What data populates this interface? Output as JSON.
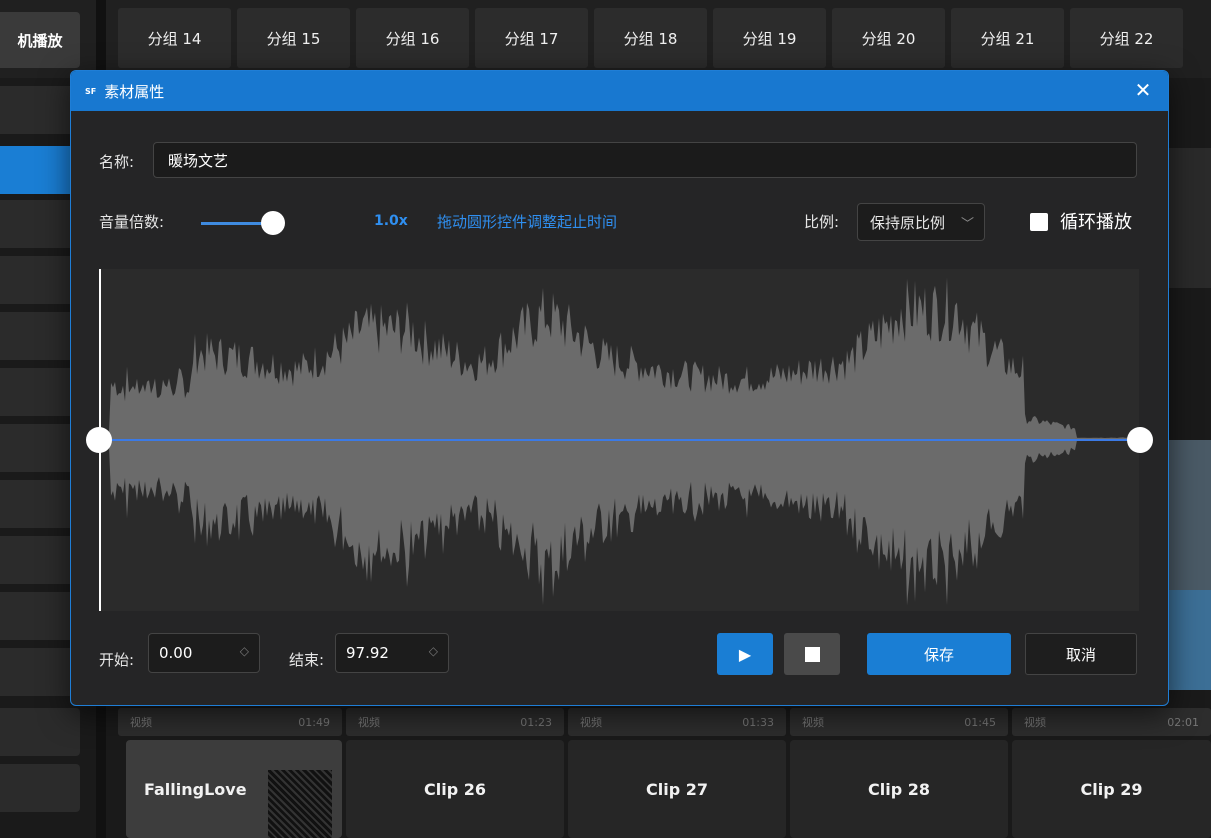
{
  "background": {
    "mode_button": "机播放",
    "group_tabs": [
      "分组 14",
      "分组 15",
      "分组 16",
      "分组 17",
      "分组 18",
      "分组 19",
      "分组 20",
      "分组 21",
      "分组 22"
    ],
    "clips": [
      {
        "type": "视频",
        "duration": "01:49",
        "name": "FallingLove"
      },
      {
        "type": "视频",
        "duration": "01:23",
        "name": "Clip 26"
      },
      {
        "type": "视频",
        "duration": "01:33",
        "name": "Clip 27"
      },
      {
        "type": "视频",
        "duration": "01:45",
        "name": "Clip 28"
      },
      {
        "type": "视频",
        "duration": "02:01",
        "name": "Clip 29"
      }
    ]
  },
  "dialog": {
    "logo": "SF",
    "title": "素材属性",
    "close_icon": "close-icon",
    "name_label": "名称:",
    "name_value": "暖场文艺",
    "volume_label": "音量倍数:",
    "volume_value": "1.0x",
    "hint": "拖动圆形控件调整起止时间",
    "ratio_label": "比例:",
    "ratio_value": "保持原比例",
    "loop_label": "循环播放",
    "loop_checked": true,
    "start_label": "开始:",
    "start_value": "0.00",
    "end_label": "结束:",
    "end_value": "97.92",
    "save_label": "保存",
    "cancel_label": "取消",
    "accent_color": "#1a7ed4"
  }
}
